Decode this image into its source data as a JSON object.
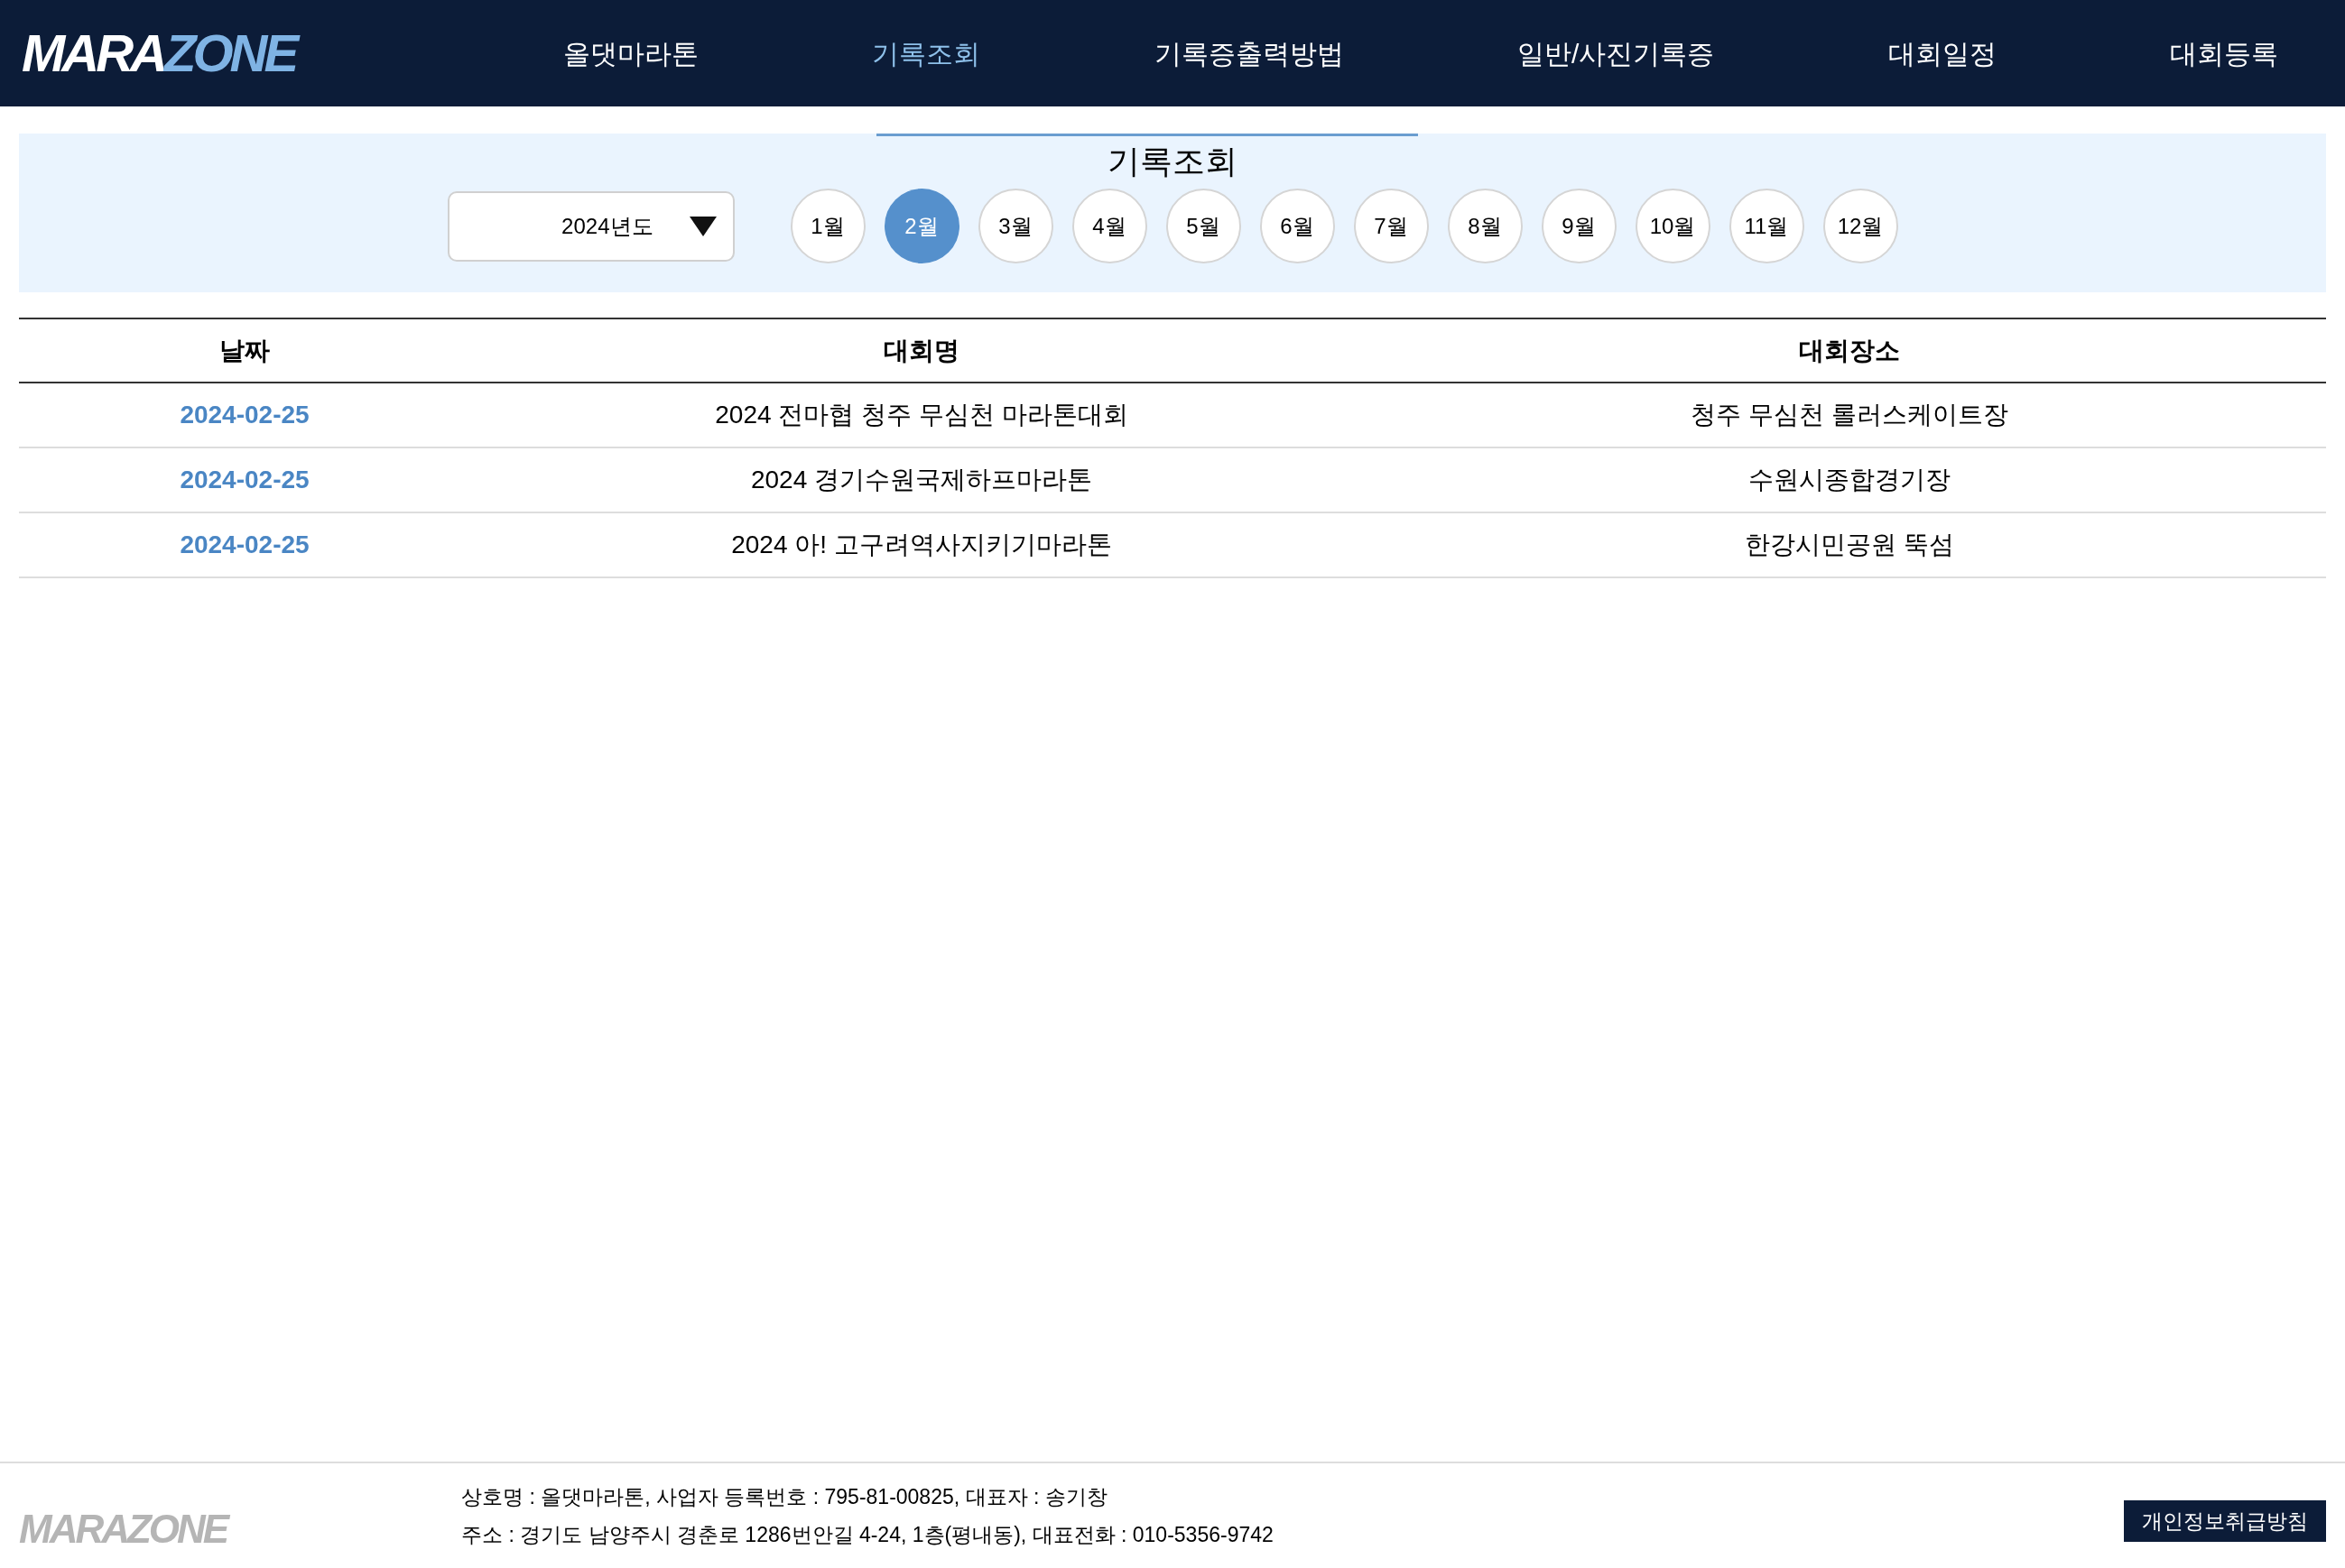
{
  "header": {
    "logo": {
      "part_1": "MARA",
      "part_2": "ZONE"
    },
    "nav": [
      {
        "label": "올댓마라톤",
        "selected": false
      },
      {
        "label": "기록조회",
        "selected": true
      },
      {
        "label": "기록증출력방법",
        "selected": false
      },
      {
        "label": "일반/사진기록증",
        "selected": false
      },
      {
        "label": "대회일정",
        "selected": false
      },
      {
        "label": "대회등록",
        "selected": false
      }
    ]
  },
  "filter": {
    "title": "기록조회",
    "year_select": {
      "value": "2024년도"
    },
    "months": [
      {
        "label": "1월",
        "selected": false
      },
      {
        "label": "2월",
        "selected": true
      },
      {
        "label": "3월",
        "selected": false
      },
      {
        "label": "4월",
        "selected": false
      },
      {
        "label": "5월",
        "selected": false
      },
      {
        "label": "6월",
        "selected": false
      },
      {
        "label": "7월",
        "selected": false
      },
      {
        "label": "8월",
        "selected": false
      },
      {
        "label": "9월",
        "selected": false
      },
      {
        "label": "10월",
        "selected": false
      },
      {
        "label": "11월",
        "selected": false
      },
      {
        "label": "12월",
        "selected": false
      }
    ]
  },
  "table": {
    "columns": [
      "날짜",
      "대회명",
      "대회장소"
    ],
    "rows": [
      [
        "2024-02-25",
        "2024 전마협 청주 무심천 마라톤대회",
        "청주 무심천 롤러스케이트장"
      ],
      [
        "2024-02-25",
        "2024 경기수원국제하프마라톤",
        "수원시종합경기장"
      ],
      [
        "2024-02-25",
        "2024 아! 고구려역사지키기마라톤",
        "한강시민공원 뚝섬"
      ]
    ]
  },
  "footer": {
    "logo": "MARAZONE",
    "lines": [
      "상호명 : 올댓마라톤, 사업자 등록번호 : 795-81-00825, 대표자 : 송기창",
      "주소 : 경기도 남양주시 경춘로 1286번안길 4-24, 1층(평내동), 대표전화 : 010-5356-9742"
    ],
    "privacy_button": "개인정보취급방침"
  }
}
